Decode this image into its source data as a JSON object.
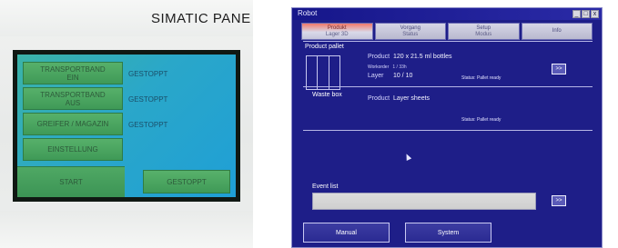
{
  "left_panel": {
    "brand": "SIMATIC PANE",
    "buttons": [
      {
        "line1": "TRANSPORTBAND",
        "line2": "EIN"
      },
      {
        "line1": "TRANSPORTBAND",
        "line2": "AUS"
      },
      {
        "line1": "GREIFER / MAGAZIN",
        "line2": ""
      },
      {
        "line1": "EINSTELLUNG",
        "line2": ""
      }
    ],
    "statuses": [
      "GESTOPPT",
      "GESTOPPT",
      "GESTOPPT"
    ],
    "start_label": "START",
    "bottom_status": "GESTOPPT"
  },
  "window": {
    "title": "Robot",
    "controls": [
      "_",
      "□",
      "x"
    ],
    "tabs": [
      {
        "label": "Produkt",
        "sub": "Lager 3D"
      },
      {
        "label": "Vorgang",
        "sub": "Status"
      },
      {
        "label": "Setup",
        "sub": "Modus"
      },
      {
        "label": "Info",
        "sub": ""
      }
    ],
    "product_pallet": {
      "label": "Product pallet",
      "product_key": "Product",
      "product_value": "120 x 21.5 ml bottles",
      "workorder_key": "Workorder",
      "workorder_value": "1 / 33h",
      "layer_key": "Layer",
      "layer_value": "10 / 10",
      "status": "Status: Pallet ready",
      "button": ">>"
    },
    "waste_box": {
      "label": "Waste box",
      "product_key": "Product",
      "product_value": "Layer sheets",
      "status": "Status: Pallet ready"
    },
    "event_list": {
      "label": "Event list",
      "button": ">>"
    },
    "bottom_buttons": {
      "manual": "Manual",
      "system": "System"
    }
  }
}
